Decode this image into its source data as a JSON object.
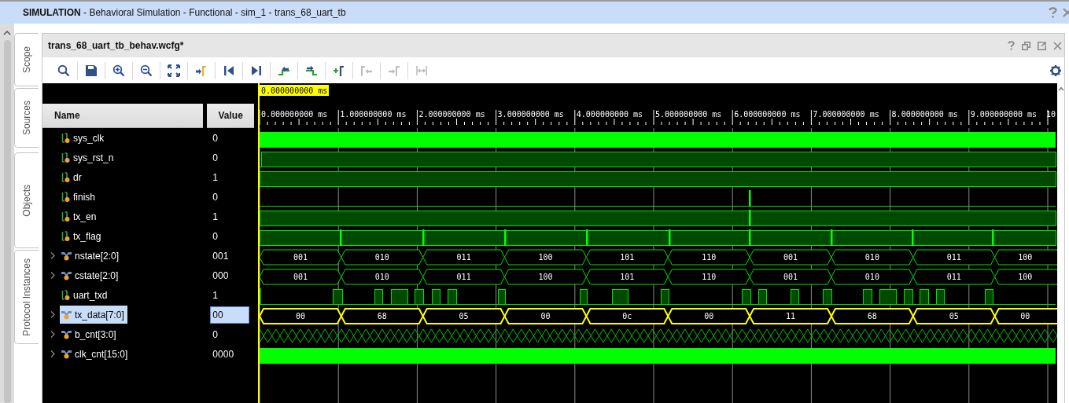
{
  "title_bar": {
    "title": "**SIMULATION** - Behavioral Simulation - Functional - sim_1 - trans_68_uart_tb"
  },
  "side_tabs": [
    {
      "label": "Scope"
    },
    {
      "label": "Sources"
    },
    {
      "label": "Objects"
    },
    {
      "label": "Protocol Instances"
    }
  ],
  "panel": {
    "title": "trans_68_uart_tb_behav.wcfg*"
  },
  "toolbar": [
    {
      "kind": "search",
      "disabled": false
    },
    {
      "kind": "save",
      "disabled": false
    },
    {
      "kind": "zoom-in",
      "disabled": false
    },
    {
      "kind": "zoom-out",
      "disabled": false
    },
    {
      "kind": "fit",
      "disabled": false
    },
    {
      "kind": "to-cursor",
      "disabled": false
    },
    {
      "kind": "to-start",
      "disabled": false
    },
    {
      "kind": "to-end",
      "disabled": false
    },
    {
      "kind": "prev-edge",
      "disabled": false
    },
    {
      "kind": "next-edge",
      "disabled": false
    },
    {
      "kind": "add-marker",
      "disabled": false
    },
    {
      "kind": "prev-marker",
      "disabled": true
    },
    {
      "kind": "next-marker",
      "disabled": true
    },
    {
      "kind": "swap-markers",
      "disabled": true
    }
  ],
  "cursor": {
    "time": "0.000000000 ms"
  },
  "ruler": {
    "labels": [
      "0.000000000 ms",
      "1.000000000 ms",
      "2.000000000 ms",
      "3.000000000 ms",
      "4.000000000 ms",
      "5.000000000 ms",
      "6.000000000 ms",
      "7.000000000 ms",
      "8.000000000 ms",
      "9.000000000 ms",
      "10"
    ]
  },
  "columns": {
    "name": "Name",
    "value": "Value"
  },
  "signals": [
    {
      "name": "sys_clk",
      "value": "0",
      "kind": "clock",
      "selected": false
    },
    {
      "name": "sys_rst_n",
      "value": "0",
      "kind": "bit",
      "selected": false
    },
    {
      "name": "dr",
      "value": "1",
      "kind": "bit",
      "selected": false
    },
    {
      "name": "finish",
      "value": "0",
      "kind": "bit",
      "selected": false
    },
    {
      "name": "tx_en",
      "value": "1",
      "kind": "bit",
      "selected": false
    },
    {
      "name": "tx_flag",
      "value": "0",
      "kind": "bit",
      "selected": false
    },
    {
      "name": "nstate[2:0]",
      "value": "001",
      "kind": "bus",
      "selected": false,
      "expanded": false,
      "segments": [
        "001",
        "010",
        "011",
        "100",
        "101",
        "110",
        "001",
        "010",
        "011",
        "100"
      ]
    },
    {
      "name": "cstate[2:0]",
      "value": "000",
      "kind": "bus",
      "selected": false,
      "expanded": false,
      "segments": [
        "001",
        "010",
        "011",
        "100",
        "101",
        "110",
        "001",
        "010",
        "011",
        "100"
      ]
    },
    {
      "name": "uart_txd",
      "value": "1",
      "kind": "bit",
      "selected": false
    },
    {
      "name": "tx_data[7:0]",
      "value": "00",
      "kind": "bus",
      "selected": true,
      "expanded": false,
      "segments": [
        "00",
        "68",
        "05",
        "00",
        "0c",
        "00",
        "11",
        "68",
        "05",
        "00"
      ]
    },
    {
      "name": "b_cnt[3:0]",
      "value": "0",
      "kind": "counter",
      "selected": false,
      "expanded": false
    },
    {
      "name": "clk_cnt[15:0]",
      "value": "0000",
      "kind": "packed",
      "selected": false,
      "expanded": false
    }
  ]
}
